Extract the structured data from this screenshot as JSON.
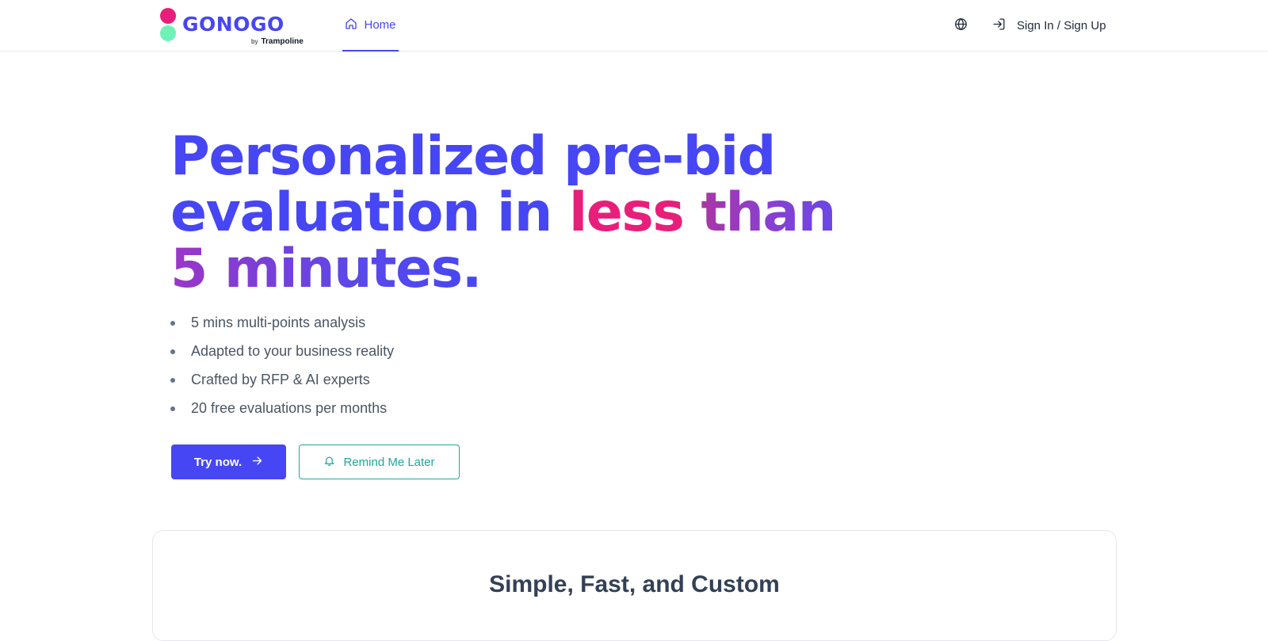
{
  "colors": {
    "primary": "#4646f5",
    "pink": "#e91e7a",
    "mint": "#6ef2b6",
    "teal": "#20a898",
    "text_dark": "#334155"
  },
  "header": {
    "logo": {
      "wordmark": "GONOGO",
      "by": "by",
      "brand": "Trampoline"
    },
    "nav": {
      "home_label": "Home",
      "home_icon": "home-icon"
    },
    "language_icon": "globe-icon",
    "signin": {
      "icon": "sign-in-icon",
      "label": "Sign In / Sign Up"
    }
  },
  "hero": {
    "headline_part1": "Personalized pre-bid",
    "headline_part2": "evaluation in ",
    "headline_highlight1": "less",
    "headline_highlight2": " than",
    "headline_part3": "5 minutes.",
    "bullets": [
      "5 mins multi-points analysis",
      "Adapted to your business reality",
      "Crafted by RFP & AI experts",
      "20 free evaluations per months"
    ],
    "try_button": {
      "label": "Try now.",
      "icon": "arrow-right-icon"
    },
    "remind_button": {
      "label": "Remind Me Later",
      "icon": "bell-icon"
    }
  },
  "features_card": {
    "title": "Simple, Fast, and Custom"
  }
}
